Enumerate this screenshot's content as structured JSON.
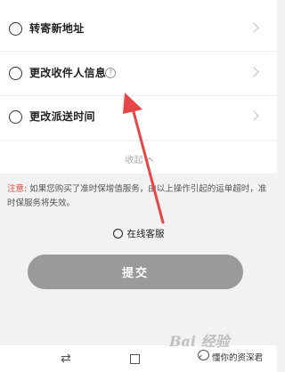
{
  "options": [
    {
      "label": "转寄新地址",
      "help": false
    },
    {
      "label": "更改收件人信息",
      "help": true
    },
    {
      "label": "更改派送时间",
      "help": false
    }
  ],
  "collapse_label": "收起",
  "notice": {
    "label": "注意:",
    "text": "如果您购买了准时保增值服务，由以上操作引起的运单超时，准时保服务将失效。"
  },
  "support_label": "在线客服",
  "submit_label": "提交",
  "help_glyph": "?",
  "watermark": {
    "brand": "Bai 经验",
    "account": "懂你的资深君"
  },
  "nav": {
    "back_glyph": "⇄",
    "recent_glyph": "‹"
  },
  "colors": {
    "notice_label": "#e0483b",
    "arrow": "#e64646",
    "submit_bg": "#9a9a9a"
  }
}
